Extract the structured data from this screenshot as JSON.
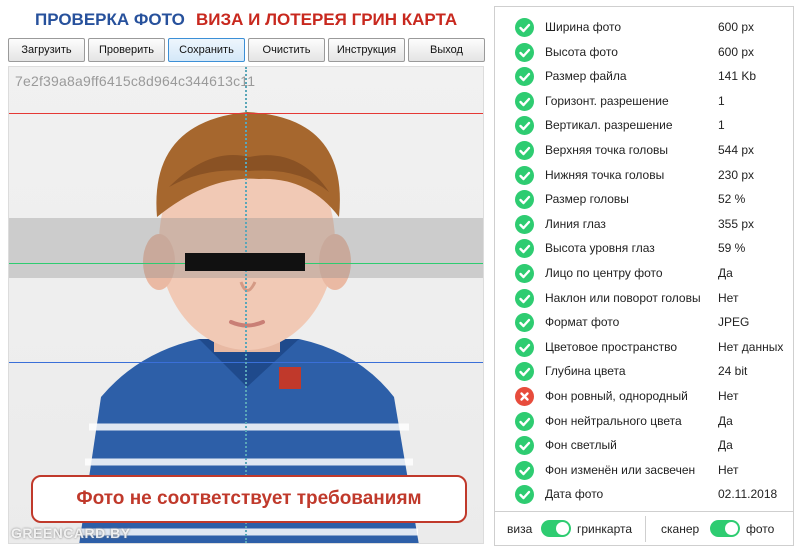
{
  "header": {
    "title_left": "ПРОВЕРКА ФОТО",
    "title_right": "ВИЗА И ЛОТЕРЕЯ ГРИН КАРТА",
    "title_left_color": "#27519c",
    "title_right_color": "#c8281e"
  },
  "toolbar": {
    "buttons": [
      {
        "label": "Загрузить"
      },
      {
        "label": "Проверить"
      },
      {
        "label": "Сохранить",
        "active": true
      },
      {
        "label": "Очистить"
      },
      {
        "label": "Инструкция"
      },
      {
        "label": "Выход"
      }
    ]
  },
  "photo": {
    "hash": "7e2f39a8a9ff6415c8d964c344613c11",
    "status_message": "Фото не соответствует требованиям",
    "status_color": "#c0392b",
    "watermark": "GREENCARD.BY",
    "guide_line_colors": {
      "top": "#e53935",
      "eyes": "#2ecc71",
      "bottom": "#3a6fd8"
    }
  },
  "checks": [
    {
      "label": "Ширина фото",
      "value": "600 px",
      "ok": true
    },
    {
      "label": "Высота фото",
      "value": "600 px",
      "ok": true
    },
    {
      "label": "Размер файла",
      "value": "141 Kb",
      "ok": true
    },
    {
      "label": "Горизонт. разрешение",
      "value": "1",
      "ok": true
    },
    {
      "label": "Вертикал. разрешение",
      "value": "1",
      "ok": true
    },
    {
      "label": "Верхняя точка головы",
      "value": "544 px",
      "ok": true
    },
    {
      "label": "Нижняя точка головы",
      "value": "230 px",
      "ok": true
    },
    {
      "label": "Размер головы",
      "value": "52 %",
      "ok": true
    },
    {
      "label": "Линия глаз",
      "value": "355 px",
      "ok": true
    },
    {
      "label": "Высота уровня глаз",
      "value": "59 %",
      "ok": true
    },
    {
      "label": "Лицо по центру фото",
      "value": "Да",
      "ok": true
    },
    {
      "label": "Наклон или поворот головы",
      "value": "Нет",
      "ok": true
    },
    {
      "label": "Формат фото",
      "value": "JPEG",
      "ok": true
    },
    {
      "label": "Цветовое пространство",
      "value": "Нет данных",
      "ok": true
    },
    {
      "label": "Глубина цвета",
      "value": "24 bit",
      "ok": true
    },
    {
      "label": "Фон ровный, однородный",
      "value": "Нет",
      "ok": false
    },
    {
      "label": "Фон нейтрального цвета",
      "value": "Да",
      "ok": true
    },
    {
      "label": "Фон светлый",
      "value": "Да",
      "ok": true
    },
    {
      "label": "Фон изменён или засвечен",
      "value": "Нет",
      "ok": true
    },
    {
      "label": "Дата фото",
      "value": "02.11.2018",
      "ok": true
    }
  ],
  "status_colors": {
    "ok": "#2ecc71",
    "fail": "#e74c3c"
  },
  "toggles": {
    "left": {
      "off_label": "виза",
      "on_label": "гринкарта"
    },
    "right": {
      "off_label": "сканер",
      "on_label": "фото"
    }
  }
}
